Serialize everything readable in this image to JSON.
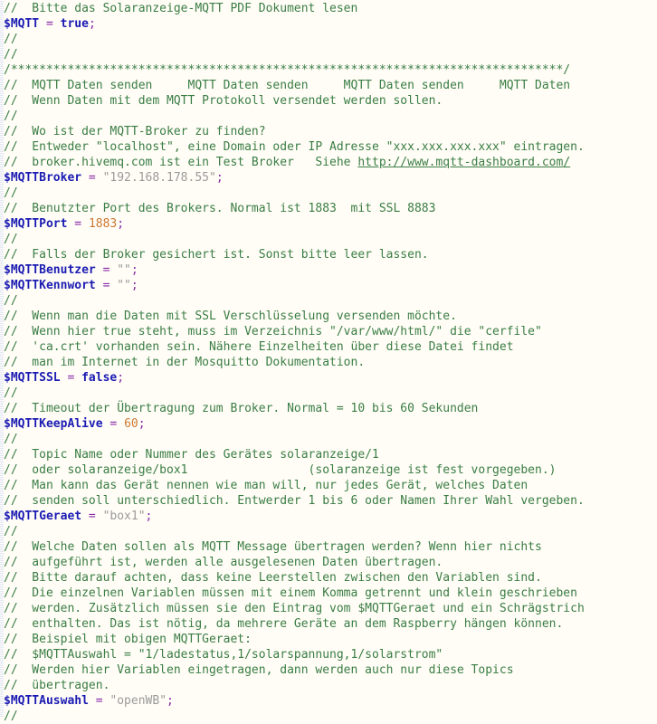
{
  "editor": {
    "name": "php-code-editor",
    "background_color": "#fffdf6",
    "colors": {
      "comment": "#3a7d44",
      "variable": "#1b1bb3",
      "operator": "#8a2ba8",
      "keyword": "#1b1bb3",
      "number": "#cc7832",
      "string": "#9a9a9a",
      "link": "#3a7d44"
    },
    "font_size_px": 13,
    "line_height_px": 17
  },
  "lines": [
    {
      "id": "l1",
      "tokens": [
        {
          "t": "c",
          "v": "//  Bitte das Solaranzeige-MQTT PDF Dokument lesen"
        }
      ]
    },
    {
      "id": "l2",
      "tokens": [
        {
          "t": "var",
          "v": "$MQTT"
        },
        {
          "t": "op",
          "v": " = "
        },
        {
          "t": "kw",
          "v": "true"
        },
        {
          "t": "op",
          "v": ";"
        }
      ]
    },
    {
      "id": "l3",
      "tokens": [
        {
          "t": "c",
          "v": "//"
        }
      ]
    },
    {
      "id": "l4",
      "tokens": [
        {
          "t": "c",
          "v": "//"
        }
      ]
    },
    {
      "id": "l5",
      "tokens": [
        {
          "t": "c",
          "v": "/******************************************************************************/"
        }
      ]
    },
    {
      "id": "l6",
      "tokens": [
        {
          "t": "c",
          "v": "//  MQTT Daten senden     MQTT Daten senden     MQTT Daten senden     MQTT Daten"
        }
      ]
    },
    {
      "id": "l7",
      "tokens": [
        {
          "t": "c",
          "v": "//  Wenn Daten mit dem MQTT Protokoll versendet werden sollen."
        }
      ]
    },
    {
      "id": "l8",
      "tokens": [
        {
          "t": "c",
          "v": "//"
        }
      ]
    },
    {
      "id": "l9",
      "tokens": [
        {
          "t": "c",
          "v": "//  Wo ist der MQTT-Broker zu finden?"
        }
      ]
    },
    {
      "id": "l10",
      "tokens": [
        {
          "t": "c",
          "v": "//  Entweder \"localhost\", eine Domain oder IP Adresse \"xxx.xxx.xxx.xxx\" eintragen."
        }
      ]
    },
    {
      "id": "l11",
      "tokens": [
        {
          "t": "c",
          "v": "//  broker.hivemq.com ist ein Test Broker   Siehe "
        },
        {
          "t": "lnk",
          "v": "http://www.mqtt-dashboard.com/"
        }
      ]
    },
    {
      "id": "l12",
      "tokens": [
        {
          "t": "var",
          "v": "$MQTTBroker"
        },
        {
          "t": "op",
          "v": " = "
        },
        {
          "t": "str",
          "v": "\"192.168.178.55\""
        },
        {
          "t": "op",
          "v": ";"
        }
      ]
    },
    {
      "id": "l13",
      "tokens": [
        {
          "t": "c",
          "v": "//"
        }
      ]
    },
    {
      "id": "l14",
      "tokens": [
        {
          "t": "c",
          "v": "//  Benutzter Port des Brokers. Normal ist 1883  mit SSL 8883"
        }
      ]
    },
    {
      "id": "l15",
      "tokens": [
        {
          "t": "var",
          "v": "$MQTTPort"
        },
        {
          "t": "op",
          "v": " = "
        },
        {
          "t": "num",
          "v": "1883"
        },
        {
          "t": "op",
          "v": ";"
        }
      ]
    },
    {
      "id": "l16",
      "tokens": [
        {
          "t": "c",
          "v": "//"
        }
      ]
    },
    {
      "id": "l17",
      "tokens": [
        {
          "t": "c",
          "v": "//  Falls der Broker gesichert ist. Sonst bitte leer lassen."
        }
      ]
    },
    {
      "id": "l18",
      "tokens": [
        {
          "t": "var",
          "v": "$MQTTBenutzer"
        },
        {
          "t": "op",
          "v": " = "
        },
        {
          "t": "str",
          "v": "\"\""
        },
        {
          "t": "op",
          "v": ";"
        }
      ]
    },
    {
      "id": "l19",
      "tokens": [
        {
          "t": "var",
          "v": "$MQTTKennwort"
        },
        {
          "t": "op",
          "v": " = "
        },
        {
          "t": "str",
          "v": "\"\""
        },
        {
          "t": "op",
          "v": ";"
        }
      ]
    },
    {
      "id": "l20",
      "tokens": [
        {
          "t": "c",
          "v": "//"
        }
      ]
    },
    {
      "id": "l21",
      "tokens": [
        {
          "t": "c",
          "v": "//  Wenn man die Daten mit SSL Verschlüsselung versenden möchte."
        }
      ]
    },
    {
      "id": "l22",
      "tokens": [
        {
          "t": "c",
          "v": "//  Wenn hier true steht, muss im Verzeichnis \"/var/www/html/\" die \"cerfile\""
        }
      ]
    },
    {
      "id": "l23",
      "tokens": [
        {
          "t": "c",
          "v": "//  'ca.crt' vorhanden sein. Nähere Einzelheiten über diese Datei findet"
        }
      ]
    },
    {
      "id": "l24",
      "tokens": [
        {
          "t": "c",
          "v": "//  man im Internet in der Mosquitto Dokumentation."
        }
      ]
    },
    {
      "id": "l25",
      "tokens": [
        {
          "t": "var",
          "v": "$MQTTSSL"
        },
        {
          "t": "op",
          "v": " = "
        },
        {
          "t": "kw",
          "v": "false"
        },
        {
          "t": "op",
          "v": ";"
        }
      ]
    },
    {
      "id": "l26",
      "tokens": [
        {
          "t": "c",
          "v": "//"
        }
      ]
    },
    {
      "id": "l27",
      "tokens": [
        {
          "t": "c",
          "v": "//  Timeout der Übertragung zum Broker. Normal = 10 bis 60 Sekunden"
        }
      ]
    },
    {
      "id": "l28",
      "tokens": [
        {
          "t": "var",
          "v": "$MQTTKeepAlive"
        },
        {
          "t": "op",
          "v": " = "
        },
        {
          "t": "num",
          "v": "60"
        },
        {
          "t": "op",
          "v": ";"
        }
      ]
    },
    {
      "id": "l29",
      "tokens": [
        {
          "t": "c",
          "v": "//"
        }
      ]
    },
    {
      "id": "l30",
      "tokens": [
        {
          "t": "c",
          "v": "//  Topic Name oder Nummer des Gerätes solaranzeige/1"
        }
      ]
    },
    {
      "id": "l31",
      "tokens": [
        {
          "t": "c",
          "v": "//  oder solaranzeige/box1                 (solaranzeige ist fest vorgegeben.)"
        }
      ]
    },
    {
      "id": "l32",
      "tokens": [
        {
          "t": "c",
          "v": "//  Man kann das Gerät nennen wie man will, nur jedes Gerät, welches Daten"
        }
      ]
    },
    {
      "id": "l33",
      "tokens": [
        {
          "t": "c",
          "v": "//  senden soll unterschiedlich. Entwerder 1 bis 6 oder Namen Ihrer Wahl vergeben."
        }
      ]
    },
    {
      "id": "l34",
      "tokens": [
        {
          "t": "var",
          "v": "$MQTTGeraet"
        },
        {
          "t": "op",
          "v": " = "
        },
        {
          "t": "str",
          "v": "\"box1\""
        },
        {
          "t": "op",
          "v": ";"
        }
      ]
    },
    {
      "id": "l35",
      "tokens": [
        {
          "t": "c",
          "v": "//"
        }
      ]
    },
    {
      "id": "l36",
      "tokens": [
        {
          "t": "c",
          "v": "//  Welche Daten sollen als MQTT Message übertragen werden? Wenn hier nichts"
        }
      ]
    },
    {
      "id": "l37",
      "tokens": [
        {
          "t": "c",
          "v": "//  aufgeführt ist, werden alle ausgelesenen Daten übertragen."
        }
      ]
    },
    {
      "id": "l38",
      "tokens": [
        {
          "t": "c",
          "v": "//  Bitte darauf achten, dass keine Leerstellen zwischen den Variablen sind."
        }
      ]
    },
    {
      "id": "l39",
      "tokens": [
        {
          "t": "c",
          "v": "//  Die einzelnen Variablen müssen mit einem Komma getrennt und klein geschrieben"
        }
      ]
    },
    {
      "id": "l40",
      "tokens": [
        {
          "t": "c",
          "v": "//  werden. Zusätzlich müssen sie den Eintrag vom $MQTTGeraet und ein Schrägstrich"
        }
      ]
    },
    {
      "id": "l41",
      "tokens": [
        {
          "t": "c",
          "v": "//  enthalten. Das ist nötig, da mehrere Geräte an dem Raspberry hängen können."
        }
      ]
    },
    {
      "id": "l42",
      "tokens": [
        {
          "t": "c",
          "v": "//  Beispiel mit obigen MQTTGeraet:"
        }
      ]
    },
    {
      "id": "l43",
      "tokens": [
        {
          "t": "c",
          "v": "//  $MQTTAuswahl = \"1/ladestatus,1/solarspannung,1/solarstrom\""
        }
      ]
    },
    {
      "id": "l44",
      "tokens": [
        {
          "t": "c",
          "v": "//  Werden hier Variablen eingetragen, dann werden auch nur diese Topics"
        }
      ]
    },
    {
      "id": "l45",
      "tokens": [
        {
          "t": "c",
          "v": "//  übertragen."
        }
      ]
    },
    {
      "id": "l46",
      "tokens": [
        {
          "t": "var",
          "v": "$MQTTAuswahl"
        },
        {
          "t": "op",
          "v": " = "
        },
        {
          "t": "str",
          "v": "\"openWB\""
        },
        {
          "t": "op",
          "v": ";"
        }
      ]
    },
    {
      "id": "l47",
      "tokens": [
        {
          "t": "c",
          "v": "//"
        }
      ]
    }
  ]
}
